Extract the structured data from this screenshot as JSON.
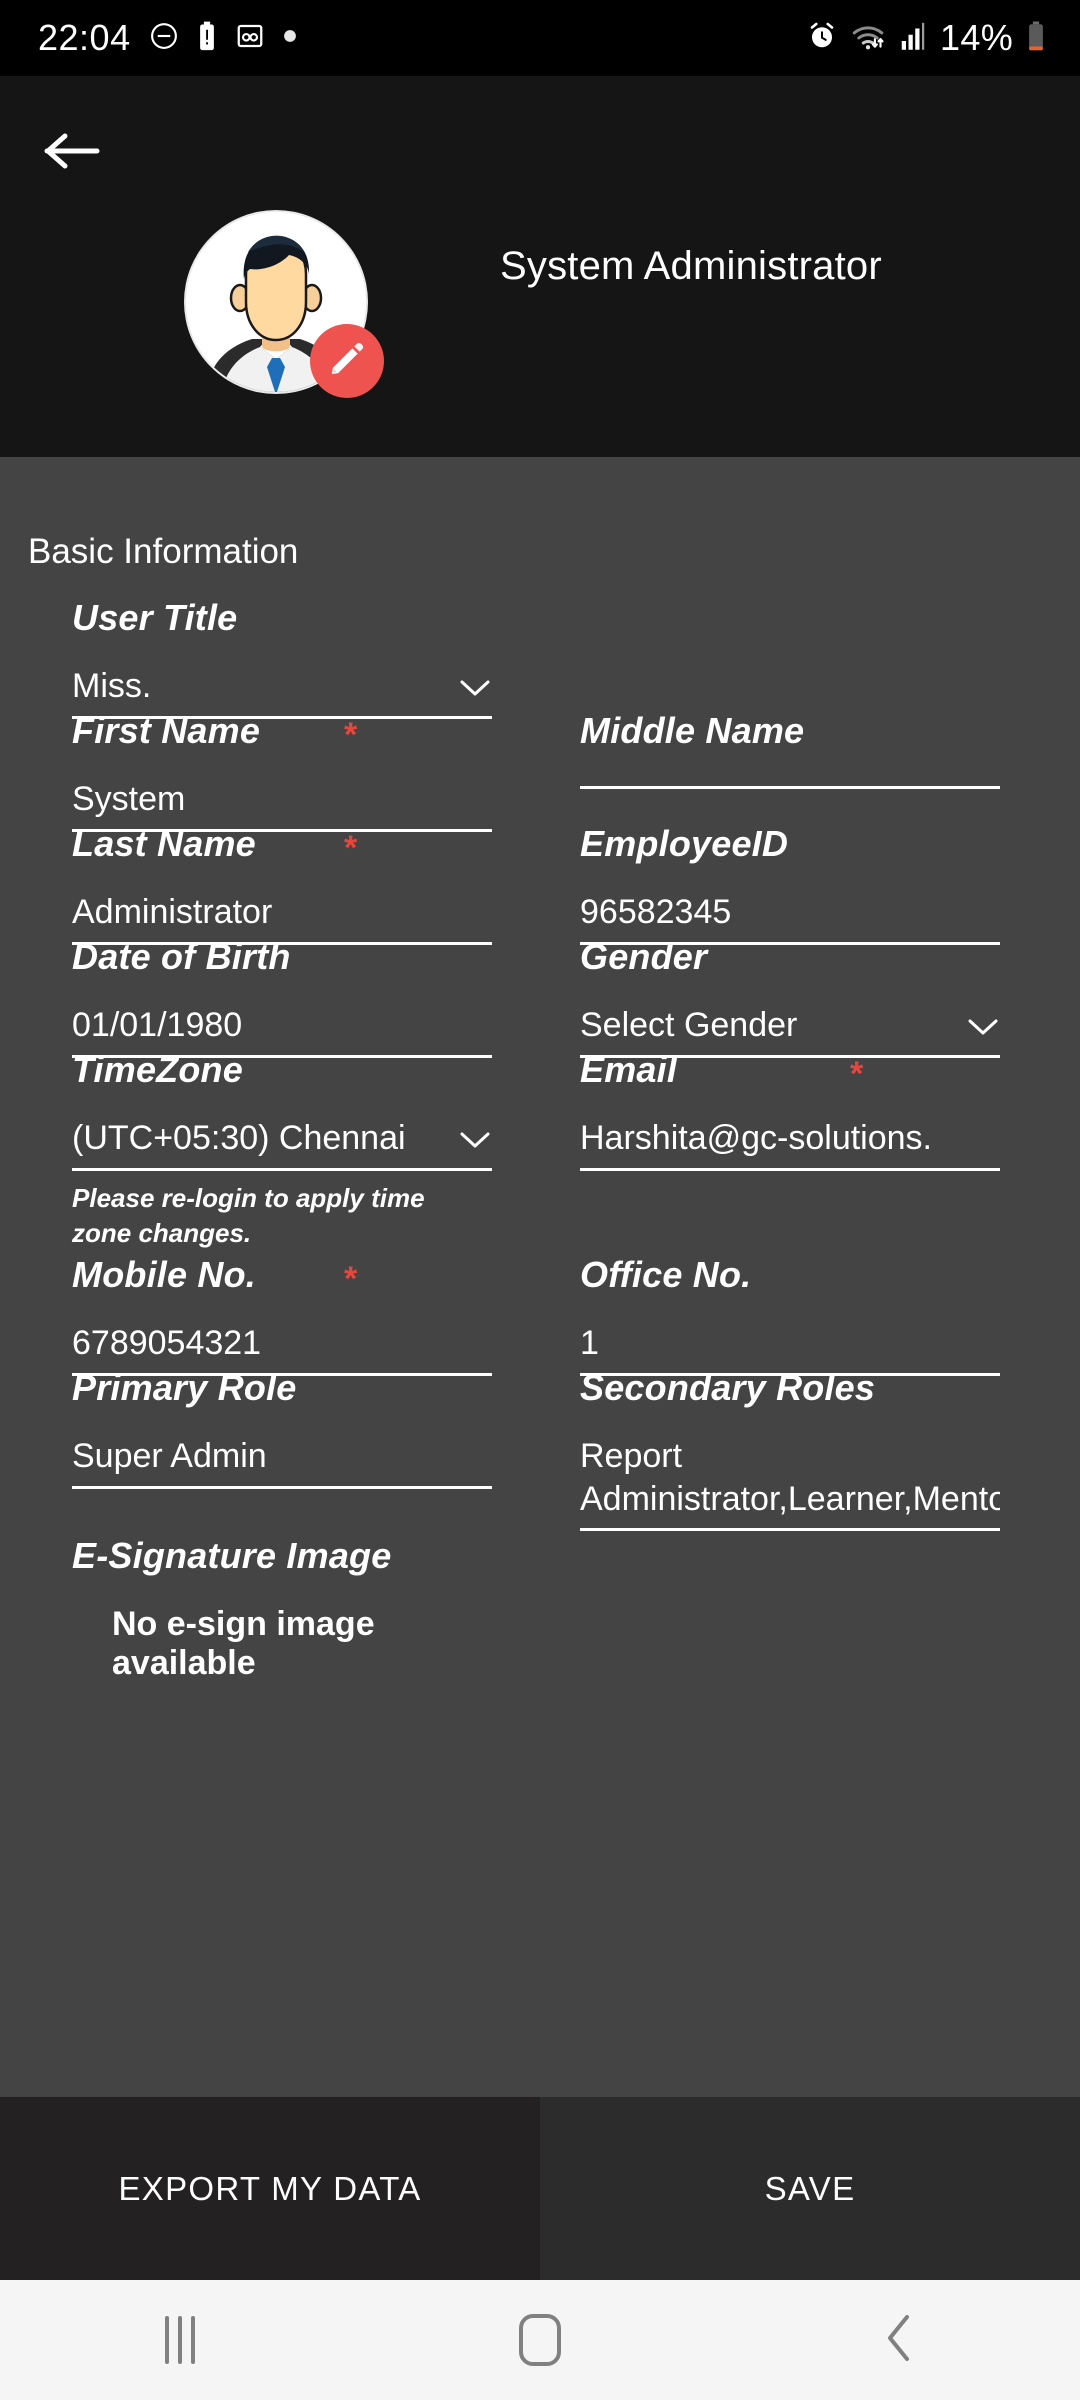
{
  "status_bar": {
    "time": "22:04",
    "battery_percent": "14%",
    "left_icons": [
      "dnd-icon",
      "battery-alert-icon",
      "voicemail-icon",
      "dot-icon"
    ],
    "right_icons": [
      "alarm-icon",
      "wifi-icon",
      "signal-icon",
      "battery-icon"
    ]
  },
  "header": {
    "back_icon": "arrow-left-icon",
    "avatar_icon": "user-avatar",
    "edit_icon": "pencil-icon",
    "title": "System Administrator"
  },
  "main": {
    "section_title": "Basic Information",
    "fields": [
      {
        "label": "User Title",
        "value": "Miss.",
        "required": false,
        "type": "select",
        "column": "left"
      },
      {
        "label": "First Name",
        "value": "System",
        "required": true,
        "type": "text",
        "column": "left"
      },
      {
        "label": "Middle Name",
        "value": "",
        "required": false,
        "type": "text",
        "column": "right"
      },
      {
        "label": "Last Name",
        "value": "Administrator",
        "required": true,
        "type": "text",
        "column": "left"
      },
      {
        "label": "EmployeeID",
        "value": "96582345",
        "required": false,
        "type": "text",
        "column": "right"
      },
      {
        "label": "Date of Birth",
        "value": "01/01/1980",
        "required": false,
        "type": "text",
        "column": "left"
      },
      {
        "label": "Gender",
        "value": "Select Gender",
        "required": false,
        "type": "select",
        "column": "right"
      },
      {
        "label": "TimeZone",
        "value": "(UTC+05:30) Chennai",
        "required": false,
        "type": "select",
        "column": "left",
        "hint": "Please re-login to apply time zone changes."
      },
      {
        "label": "Email",
        "value": "Harshita@gc-solutions.",
        "required": true,
        "type": "text",
        "column": "right"
      },
      {
        "label": "Mobile No.",
        "value": "6789054321",
        "required": true,
        "type": "text",
        "column": "left"
      },
      {
        "label": "Office No.",
        "value": "1",
        "required": false,
        "type": "text",
        "column": "right"
      },
      {
        "label": "Primary Role",
        "value": "Super Admin",
        "required": false,
        "type": "text",
        "column": "left"
      },
      {
        "label": "Secondary Roles",
        "value": "Report Administrator,Learner,Mentor",
        "required": false,
        "type": "text",
        "column": "right"
      },
      {
        "label": "E-Signature Image",
        "value": "",
        "required": false,
        "type": "static",
        "column": "left"
      }
    ],
    "esign_note": "No e-sign image available"
  },
  "actions": {
    "export_label": "EXPORT MY DATA",
    "save_label": "SAVE"
  },
  "nav_bar": {
    "recents": "recents-icon",
    "home": "home-icon",
    "back": "back-icon"
  },
  "colors": {
    "required_asterisk": "#e8453c",
    "edit_badge": "#ef5350",
    "header_bg": "#151515",
    "body_bg": "#444444",
    "status_bg": "#000000",
    "nav_bg": "#f5f5f5"
  }
}
